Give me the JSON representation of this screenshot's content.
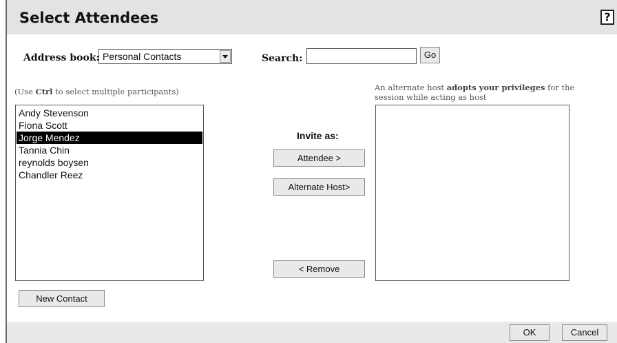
{
  "dialog": {
    "title": "Select Attendees",
    "help_label": "?"
  },
  "address_book": {
    "label": "Address book:",
    "selected": "Personal Contacts"
  },
  "search": {
    "label": "Search:",
    "value": "",
    "go_label": "Go"
  },
  "left_hint": {
    "prefix": "(Use ",
    "key": "Ctrl",
    "suffix": " to select multiple participants)"
  },
  "right_hint": {
    "prefix": "An alternate host ",
    "emph": "adopts your privileges",
    "suffix": " for the session while acting as host"
  },
  "contacts": [
    {
      "name": "Andy Stevenson",
      "selected": false
    },
    {
      "name": "Fiona Scott",
      "selected": false
    },
    {
      "name": "Jorge Mendez",
      "selected": true
    },
    {
      "name": "Tannia Chin",
      "selected": false
    },
    {
      "name": "reynolds boysen",
      "selected": false
    },
    {
      "name": "Chandler Reez",
      "selected": false
    }
  ],
  "invite": {
    "label": "Invite as:",
    "attendee_btn": "Attendee >",
    "alt_host_btn": "Alternate Host>",
    "remove_btn": "< Remove"
  },
  "new_contact_btn": "New Contact",
  "footer": {
    "ok": "OK",
    "cancel": "Cancel"
  }
}
